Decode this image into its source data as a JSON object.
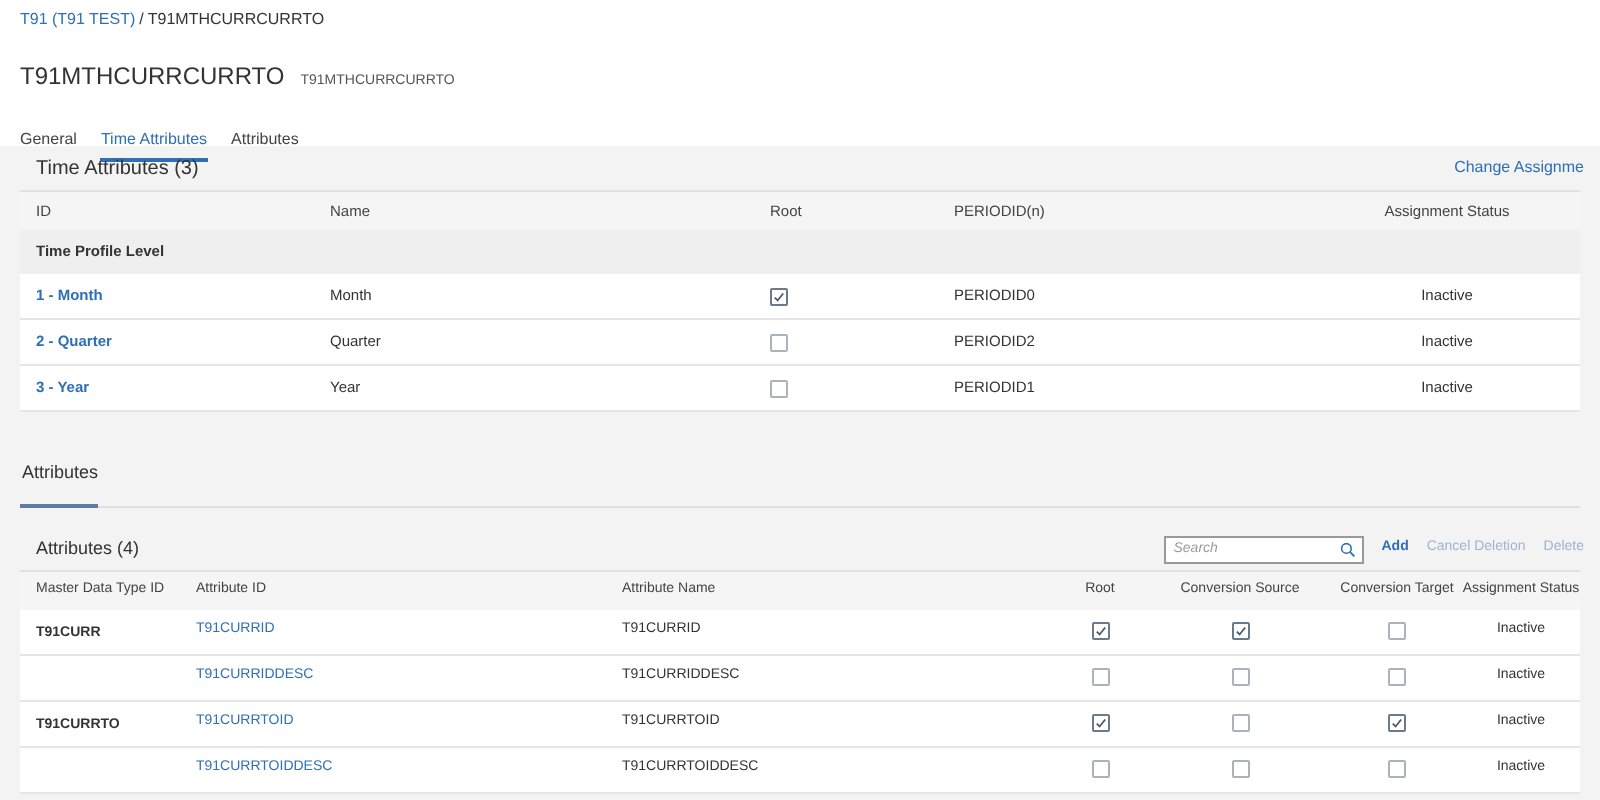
{
  "breadcrumb": {
    "link": "T91 (T91 TEST)",
    "separator": "/",
    "current": "T91MTHCURRCURRTO"
  },
  "header": {
    "title": "T91MTHCURRCURRTO",
    "subtitle": "T91MTHCURRCURRTO"
  },
  "tabs": [
    {
      "label": "General",
      "selected": false
    },
    {
      "label": "Time Attributes",
      "selected": true
    },
    {
      "label": "Attributes",
      "selected": false
    }
  ],
  "time_attributes": {
    "title": "Time Attributes (3)",
    "action": "Change Assignme",
    "columns": [
      "ID",
      "Name",
      "Root",
      "PERIODID(n)",
      "Assignment Status"
    ],
    "group": "Time Profile Level",
    "rows": [
      {
        "id": "1 - Month",
        "name": "Month",
        "root": true,
        "period": "PERIODID0",
        "status": "Inactive"
      },
      {
        "id": "2 - Quarter",
        "name": "Quarter",
        "root": false,
        "period": "PERIODID2",
        "status": "Inactive"
      },
      {
        "id": "3 - Year",
        "name": "Year",
        "root": false,
        "period": "PERIODID1",
        "status": "Inactive"
      }
    ]
  },
  "attributes_section": {
    "title": "Attributes"
  },
  "attributes": {
    "title": "Attributes (4)",
    "search": {
      "placeholder": "Search"
    },
    "actions": [
      {
        "label": "Add",
        "disabled": false
      },
      {
        "label": "Cancel Deletion",
        "disabled": true
      },
      {
        "label": "Delete",
        "disabled": true
      }
    ],
    "columns": [
      "Master Data Type ID",
      "Attribute ID",
      "Attribute Name",
      "Root",
      "Conversion Source",
      "Conversion Target",
      "Assignment Status"
    ],
    "rows": [
      {
        "type": "T91CURR",
        "id": "T91CURRID",
        "name": "T91CURRID",
        "root": true,
        "source": true,
        "target": false,
        "status": "Inactive"
      },
      {
        "id": "T91CURRIDDESC",
        "name": "T91CURRIDDESC",
        "root": false,
        "source": false,
        "target": false,
        "status": "Inactive"
      },
      {
        "type": "T91CURRTO",
        "id": "T91CURRTOID",
        "name": "T91CURRTOID",
        "root": true,
        "source": false,
        "target": true,
        "status": "Inactive"
      },
      {
        "id": "T91CURRTOIDDESC",
        "name": "T91CURRTOIDDESC",
        "root": false,
        "source": false,
        "target": false,
        "status": "Inactive"
      }
    ]
  }
}
